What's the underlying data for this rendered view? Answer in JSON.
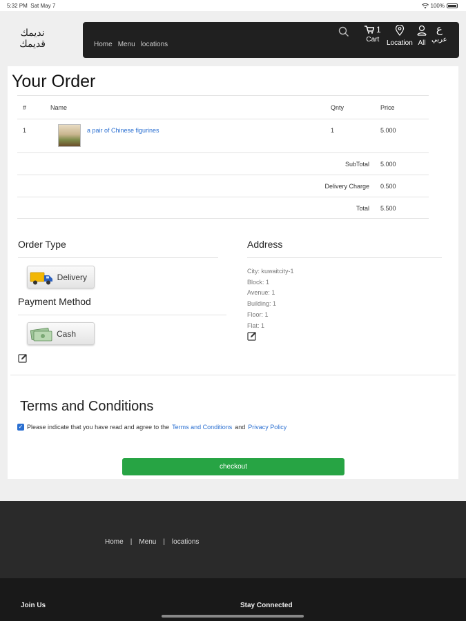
{
  "status": {
    "time": "5:32 PM",
    "date": "Sat May 7",
    "battery": "100%"
  },
  "header": {
    "logo_line1": "نديمك",
    "logo_line2": "قديمك",
    "nav": [
      "Home",
      "Menu",
      "locations"
    ],
    "cart_count": "1",
    "cart_label": "Cart",
    "location_label": "Location",
    "account_label": "All",
    "lang_glyph": "ع",
    "lang_label": "عربي"
  },
  "order": {
    "title": "Your Order",
    "columns": {
      "num": "#",
      "name": "Name",
      "qty": "Qnty",
      "price": "Price"
    },
    "items": [
      {
        "num": "1",
        "name": "a pair of Chinese figurines",
        "qty": "1",
        "price": "5.000"
      }
    ],
    "subtotal_label": "SubTotal",
    "subtotal": "5.000",
    "delivery_label": "Delivery Charge",
    "delivery": "0.500",
    "total_label": "Total",
    "total": "5.500"
  },
  "order_type": {
    "title": "Order Type",
    "option": "Delivery"
  },
  "payment": {
    "title": "Payment Method",
    "option": "Cash"
  },
  "address": {
    "title": "Address",
    "lines": [
      "City: kuwaitcity-1",
      "Block: 1",
      "Avenue: 1",
      "Building: 1",
      "Floor: 1",
      "Flat: 1"
    ]
  },
  "terms": {
    "title": "Terms and Conditions",
    "text_before": "Please indicate that you have read and agree to the",
    "terms_link": "Terms and Conditions",
    "and": "and",
    "privacy_link": "Privacy Policy"
  },
  "checkout_label": "checkout",
  "footer": {
    "links": [
      "Home",
      "|",
      "Menu",
      "|",
      "locations"
    ],
    "join": "Join Us",
    "stay": "Stay Connected"
  },
  "colors": {
    "navbar": "#202020",
    "link": "#2a6fd1",
    "checkout": "#27a444"
  }
}
